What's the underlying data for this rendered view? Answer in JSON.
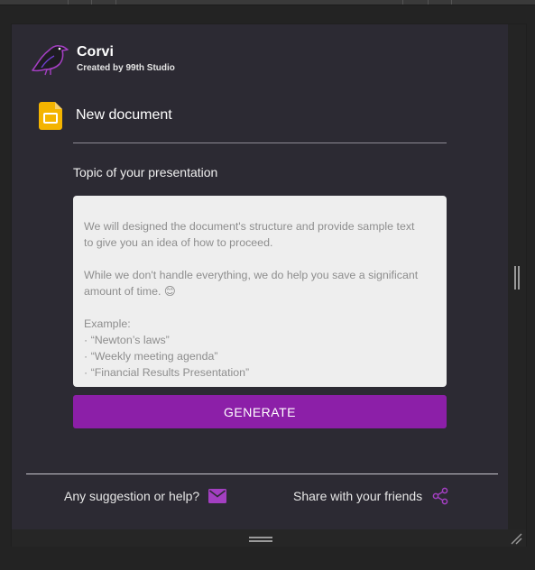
{
  "colors": {
    "accent": "#8c1fa8",
    "panel_background": "#2c2a33",
    "textarea_background": "#eeeeee",
    "icon_accent": "#a33fc1"
  },
  "header": {
    "app_name": "Corvi",
    "credit": "Created by 99th Studio",
    "logo_icon": "raven-logo-icon"
  },
  "document": {
    "icon": "google-slides-icon",
    "title": "New document"
  },
  "topic": {
    "label": "Topic of your presentation",
    "placeholder_lines": [
      "We will designed the document's structure and provide sample text",
      "to give you an idea of how to proceed.",
      "",
      "While we don't handle everything, we do help you save a significant",
      "amount of time. 😊",
      "",
      "Example:",
      "· “Newton’s laws”",
      "· “Weekly meeting agenda”",
      "· “Financial Results Presentation”"
    ]
  },
  "actions": {
    "generate_label": "GENERATE"
  },
  "footer": {
    "help_label": "Any suggestion or help?",
    "help_icon": "mail-icon",
    "share_label": "Share with your friends",
    "share_icon": "share-icon"
  }
}
